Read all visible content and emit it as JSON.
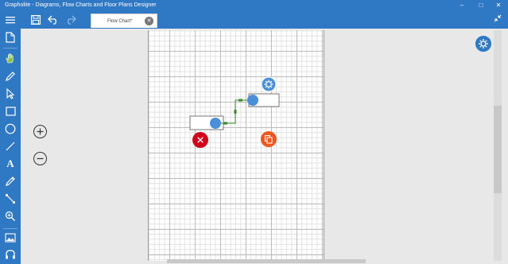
{
  "app": {
    "window_title": "Grapholite - Diagrams, Flow Charts and Floor Plans Designer",
    "controls": {
      "minimize": "–",
      "maximize": "□",
      "close": "✕"
    }
  },
  "toolbar": {
    "items": [
      {
        "name": "menu-icon"
      },
      {
        "name": "save-icon"
      },
      {
        "name": "undo-icon"
      },
      {
        "name": "redo-icon"
      }
    ]
  },
  "tabs": [
    {
      "label": "Flow Chart*",
      "close_glyph": "✕"
    }
  ],
  "sidebar": {
    "items": [
      {
        "name": "new-document-icon"
      },
      {
        "name": "pan-hand-icon"
      },
      {
        "name": "pen-icon"
      },
      {
        "name": "pointer-icon"
      },
      {
        "name": "rectangle-icon"
      },
      {
        "name": "ellipse-icon"
      },
      {
        "name": "line-icon"
      },
      {
        "name": "text-icon",
        "glyph": "A"
      },
      {
        "name": "pencil-icon"
      },
      {
        "name": "connector-icon"
      },
      {
        "name": "zoom-icon"
      },
      {
        "name": "image-icon"
      },
      {
        "name": "library-icon"
      }
    ]
  },
  "zoom": {
    "in_glyph": "+",
    "out_glyph": "−"
  },
  "colors": {
    "brand": "#2f78c4",
    "node_blue": "#4a8fd8",
    "connector_green": "#3a8a2a",
    "delete_red": "#d0021b",
    "copy_orange": "#f0561d"
  },
  "diagram": {
    "shapes": [
      {
        "name": "upper-rectangle-shape"
      },
      {
        "name": "lower-rectangle-shape"
      }
    ],
    "connector": {
      "name": "elbow-connector"
    },
    "floating_actions": [
      {
        "name": "shape-settings-button"
      },
      {
        "name": "delete-button"
      },
      {
        "name": "duplicate-button"
      }
    ]
  }
}
